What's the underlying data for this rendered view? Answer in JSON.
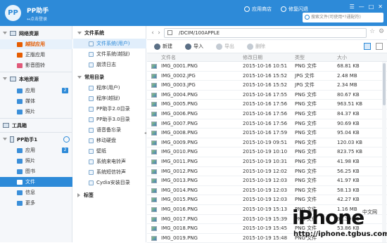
{
  "titlebar": {
    "logo": "PP",
    "app_name": "PP助手",
    "login": "↔点击登录",
    "app_store": "应用商店",
    "flash": "修复闪退",
    "search_placeholder": "搜索文件(可使用*?通配符)",
    "controls": [
      "☰",
      "—",
      "□",
      "✕"
    ]
  },
  "sidebar": {
    "sections": [
      {
        "label": "网络资源"
      },
      {
        "label": "本地资源"
      },
      {
        "label": "工具箱"
      },
      {
        "label": "PP助手1"
      }
    ],
    "items": [
      {
        "label": "越狱应用",
        "color": "#e65c00"
      },
      {
        "label": "正版应用",
        "color": "#e65c00"
      },
      {
        "label": "影音图铃",
        "color": "#e05a7a"
      },
      {
        "label": "应用",
        "badge": "2",
        "color": "#3b8fd9"
      },
      {
        "label": "媒体",
        "color": "#3b8fd9"
      },
      {
        "label": "照片",
        "color": "#3b8fd9"
      },
      {
        "label": "应用",
        "badge": "2",
        "color": "#3b8fd9"
      },
      {
        "label": "照片",
        "color": "#3b8fd9"
      },
      {
        "label": "图书",
        "color": "#3b8fd9"
      },
      {
        "label": "文件",
        "color": "#ffffff"
      },
      {
        "label": "信息",
        "color": "#3b8fd9"
      },
      {
        "label": "更多",
        "color": "#3b8fd9"
      }
    ]
  },
  "middle": {
    "sections": [
      {
        "label": "文件系统"
      },
      {
        "label": "常用目录"
      },
      {
        "label": "标签"
      }
    ],
    "fs_items": [
      "文件系统(用户)",
      "文件系统(越狱)",
      "崩溃日志"
    ],
    "common_items": [
      "程序(用户)",
      "程序(越狱)",
      "PP助手2.0目录",
      "PP助手3.0目录",
      "语音备忘录",
      "移动硬盘",
      "壁纸",
      "系统来电铃声",
      "系统短信铃声",
      "Cydia安装目录"
    ]
  },
  "right": {
    "path": "/DCIM/100APPLE",
    "toolbar": {
      "new": "新建",
      "import": "导入",
      "export": "导出",
      "delete": "删除"
    },
    "columns": [
      "文件名",
      "修改日期",
      "类型",
      "大小"
    ],
    "rows": [
      [
        "IMG_0001.PNG",
        "2015-10-16 10:51",
        "PNG 文件",
        "68.81 KB"
      ],
      [
        "IMG_0002.JPG",
        "2015-10-16 15:52",
        "JPG 文件",
        "2.48 MB"
      ],
      [
        "IMG_0003.JPG",
        "2015-10-16 15:52",
        "JPG 文件",
        "2.34 MB"
      ],
      [
        "IMG_0004.PNG",
        "2015-10-16 17:55",
        "PNG 文件",
        "80.67 KB"
      ],
      [
        "IMG_0005.PNG",
        "2015-10-16 17:56",
        "PNG 文件",
        "963.51 KB"
      ],
      [
        "IMG_0006.PNG",
        "2015-10-16 17:56",
        "PNG 文件",
        "84.37 KB"
      ],
      [
        "IMG_0007.PNG",
        "2015-10-16 17:56",
        "PNG 文件",
        "90.69 KB"
      ],
      [
        "IMG_0008.PNG",
        "2015-10-16 17:59",
        "PNG 文件",
        "95.04 KB"
      ],
      [
        "IMG_0009.PNG",
        "2015-10-19 09:51",
        "PNG 文件",
        "120.03 KB"
      ],
      [
        "IMG_0010.PNG",
        "2015-10-19 10:10",
        "PNG 文件",
        "823.75 KB"
      ],
      [
        "IMG_0011.PNG",
        "2015-10-19 10:31",
        "PNG 文件",
        "41.98 KB"
      ],
      [
        "IMG_0012.PNG",
        "2015-10-19 12:02",
        "PNG 文件",
        "56.25 KB"
      ],
      [
        "IMG_0013.PNG",
        "2015-10-19 12:03",
        "PNG 文件",
        "41.97 KB"
      ],
      [
        "IMG_0014.PNG",
        "2015-10-19 12:03",
        "PNG 文件",
        "58.13 KB"
      ],
      [
        "IMG_0015.PNG",
        "2015-10-19 12:03",
        "PNG 文件",
        "42.27 KB"
      ],
      [
        "IMG_0016.PNG",
        "2015-10-19 15:13",
        "PNG 文件",
        "1.16 MB"
      ],
      [
        "IMG_0017.PNG",
        "2015-10-19 15:39",
        "PNG 文件",
        "95.39 KB"
      ],
      [
        "IMG_0018.PNG",
        "2015-10-19 15:45",
        "PNG 文件",
        "53.86 KB"
      ],
      [
        "IMG_0019.PNG",
        "2015-10-19 15:48",
        "PNG 文件",
        ""
      ]
    ]
  },
  "watermark": {
    "logo": "iPhone",
    "cn": "中文网",
    "url": "http://iphone.tgbus.com"
  }
}
